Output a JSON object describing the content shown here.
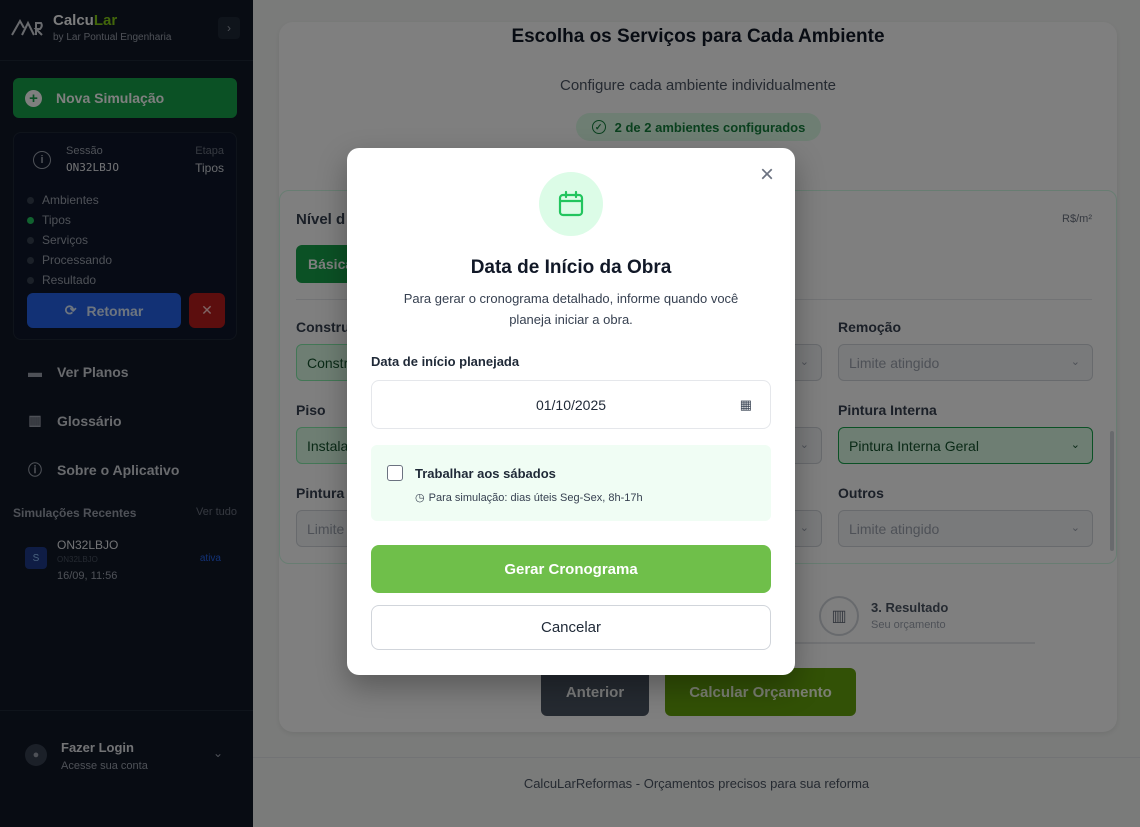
{
  "brand": {
    "title_prefix": "Calcu",
    "title_suffix": "Lar",
    "subtitle": "by Lar Pontual Engenharia",
    "logo_text": "LAR"
  },
  "sidebar": {
    "new_simulation": "Nova Simulação",
    "session": {
      "label": "Sessão",
      "code": "ON32LBJO",
      "stage_label": "Etapa",
      "stage_value": "Tipos",
      "steps": [
        {
          "label": "Ambientes",
          "active": false
        },
        {
          "label": "Tipos",
          "active": true
        },
        {
          "label": "Serviços",
          "active": false
        },
        {
          "label": "Processando",
          "active": false
        },
        {
          "label": "Resultado",
          "active": false
        }
      ],
      "resume": "Retomar",
      "discard_icon": "close-icon"
    },
    "nav": [
      {
        "label": "Ver Planos",
        "icon": "card-icon"
      },
      {
        "label": "Glossário",
        "icon": "book-icon"
      },
      {
        "label": "Sobre o Aplicativo",
        "icon": "info-icon"
      }
    ],
    "recent": {
      "title": "Simulações Recentes",
      "see_all": "Ver tudo",
      "items": [
        {
          "avatar": "S",
          "name": "ON32LBJO",
          "code": "ON32LBJO",
          "date": "16/09, 11:56",
          "status": "ativa"
        }
      ]
    },
    "login": {
      "title": "Fazer Login",
      "subtitle": "Acesse sua conta"
    }
  },
  "main": {
    "title": "Escolha os Serviços para Cada Ambiente",
    "subtitle": "Configure cada ambiente individualmente",
    "badge": "2 de 2 ambientes configurados",
    "nivel_label": "Nível d",
    "price_unit": "R$/m²",
    "nivel_option": "Básica",
    "fields": [
      {
        "label": "Construç",
        "value": "Constr",
        "style": "green"
      },
      {
        "label": "Remoção",
        "value": "Limite atingido",
        "style": "disabled"
      },
      {
        "label": "Piso",
        "value": "Instala",
        "style": "green"
      },
      {
        "label": "Pintura Interna",
        "value": "Pintura Interna Geral",
        "style": "green"
      },
      {
        "label": "Pintura e",
        "value": "Limite",
        "style": "disabled"
      },
      {
        "label": "Outros",
        "value": "Limite atingido",
        "style": "disabled"
      }
    ],
    "step3": {
      "title": "3. Resultado",
      "subtitle": "Seu orçamento"
    },
    "prev_button": "Anterior",
    "calc_button": "Calcular Orçamento",
    "footer": "CalcuLarReformas - Orçamentos precisos para sua reforma"
  },
  "modal": {
    "title": "Data de Início da Obra",
    "description": "Para gerar o cronograma detalhado, informe quando você planeja iniciar a obra.",
    "date_label": "Data de início planejada",
    "date_value": "01/10/2025",
    "saturday_label": "Trabalhar aos sábados",
    "saturday_checked": false,
    "saturday_hint": "Para simulação: dias úteis Seg-Sex, 8h-17h",
    "generate_button": "Gerar Cronograma",
    "cancel_button": "Cancelar"
  },
  "colors": {
    "sidebar_bg": "#111827",
    "primary_green": "#16a34a",
    "modal_button": "#6fbf4a",
    "resume_blue": "#2563eb",
    "discard_red": "#b91c1c"
  }
}
